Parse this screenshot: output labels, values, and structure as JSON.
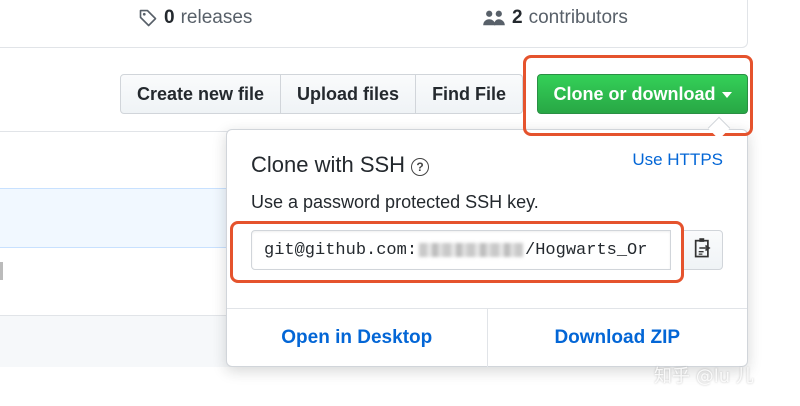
{
  "stats": {
    "releases_count": "0",
    "releases_label": "releases",
    "contributors_count": "2",
    "contributors_label": "contributors"
  },
  "toolbar": {
    "create_file": "Create new file",
    "upload_files": "Upload files",
    "find_file": "Find File",
    "clone_download": "Clone or download"
  },
  "clone_panel": {
    "title": "Clone with SSH",
    "help_symbol": "?",
    "use_https": "Use HTTPS",
    "description": "Use a password protected SSH key.",
    "url_prefix": "git@github.com:",
    "url_suffix": "/Hogwarts_Or",
    "open_desktop": "Open in Desktop",
    "download_zip": "Download ZIP"
  },
  "watermark": "知乎 @lu 儿",
  "colors": {
    "clone_green": "#28a745",
    "link_blue": "#0366d6",
    "highlight_red": "#e5532d"
  },
  "icons": [
    "tag-icon",
    "people-icon",
    "caret-down-icon",
    "question-icon",
    "clipboard-icon"
  ]
}
